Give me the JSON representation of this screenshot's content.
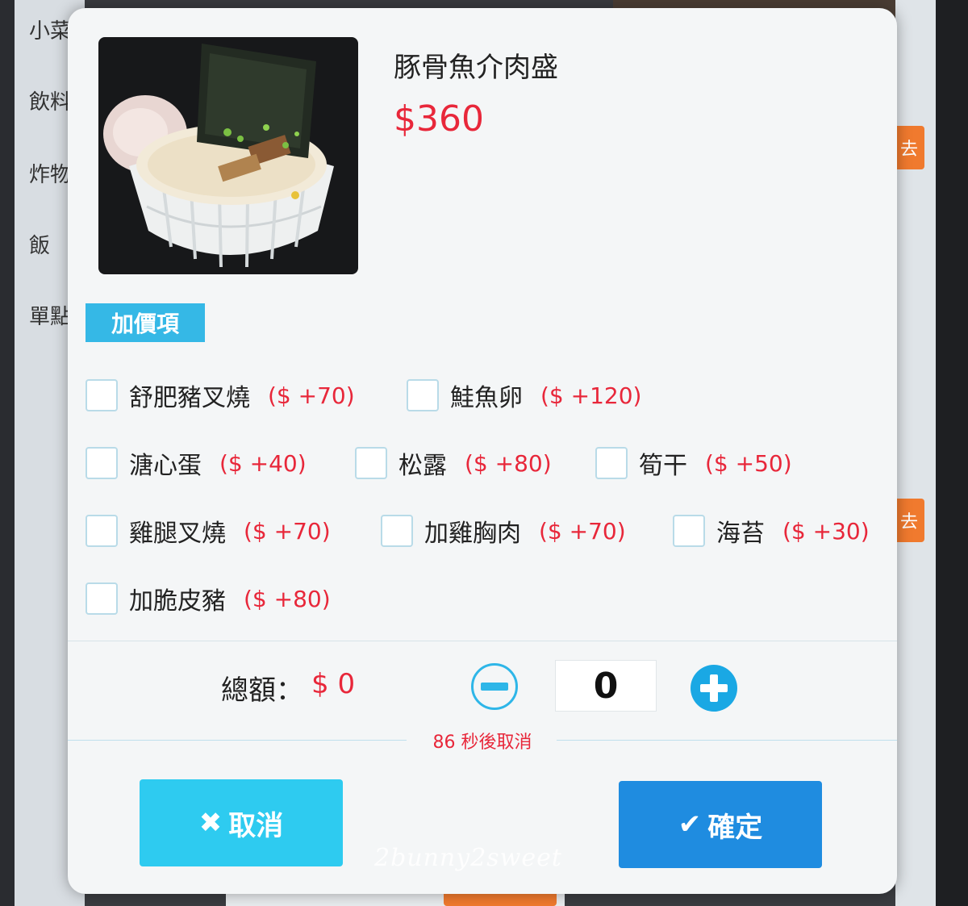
{
  "background": {
    "categories": [
      "小菜",
      "飲料",
      "炸物",
      "飯",
      "單點"
    ],
    "orange_button_label": "去"
  },
  "item": {
    "name": "豚骨魚介肉盛",
    "price": "$360"
  },
  "addons": {
    "tag_label": "加價項",
    "options": [
      {
        "name": "舒肥豬叉燒",
        "price": "($ +70)",
        "checked": false
      },
      {
        "name": "鮭魚卵",
        "price": "($ +120)",
        "checked": false
      },
      {
        "name": "溏心蛋",
        "price": "($ +40)",
        "checked": false
      },
      {
        "name": "松露",
        "price": "($ +80)",
        "checked": false
      },
      {
        "name": "筍干",
        "price": "($ +50)",
        "checked": false
      },
      {
        "name": "雞腿叉燒",
        "price": "($ +70)",
        "checked": false
      },
      {
        "name": "加雞胸肉",
        "price": "($ +70)",
        "checked": false
      },
      {
        "name": "海苔",
        "price": "($ +30)",
        "checked": false
      },
      {
        "name": "加脆皮豬",
        "price": "($ +80)",
        "checked": false
      }
    ]
  },
  "total": {
    "label": "總額：",
    "value": "$ 0"
  },
  "quantity": {
    "value": "0"
  },
  "countdown": {
    "text": "86 秒後取消"
  },
  "buttons": {
    "cancel_label": "取消",
    "confirm_label": "確定"
  },
  "watermark": "2bunny2sweet",
  "colors": {
    "accent_blue": "#1f8ce0",
    "cancel_cyan": "#2ecbf0",
    "price_red": "#e8273a",
    "tag_blue": "#35b8e6"
  }
}
